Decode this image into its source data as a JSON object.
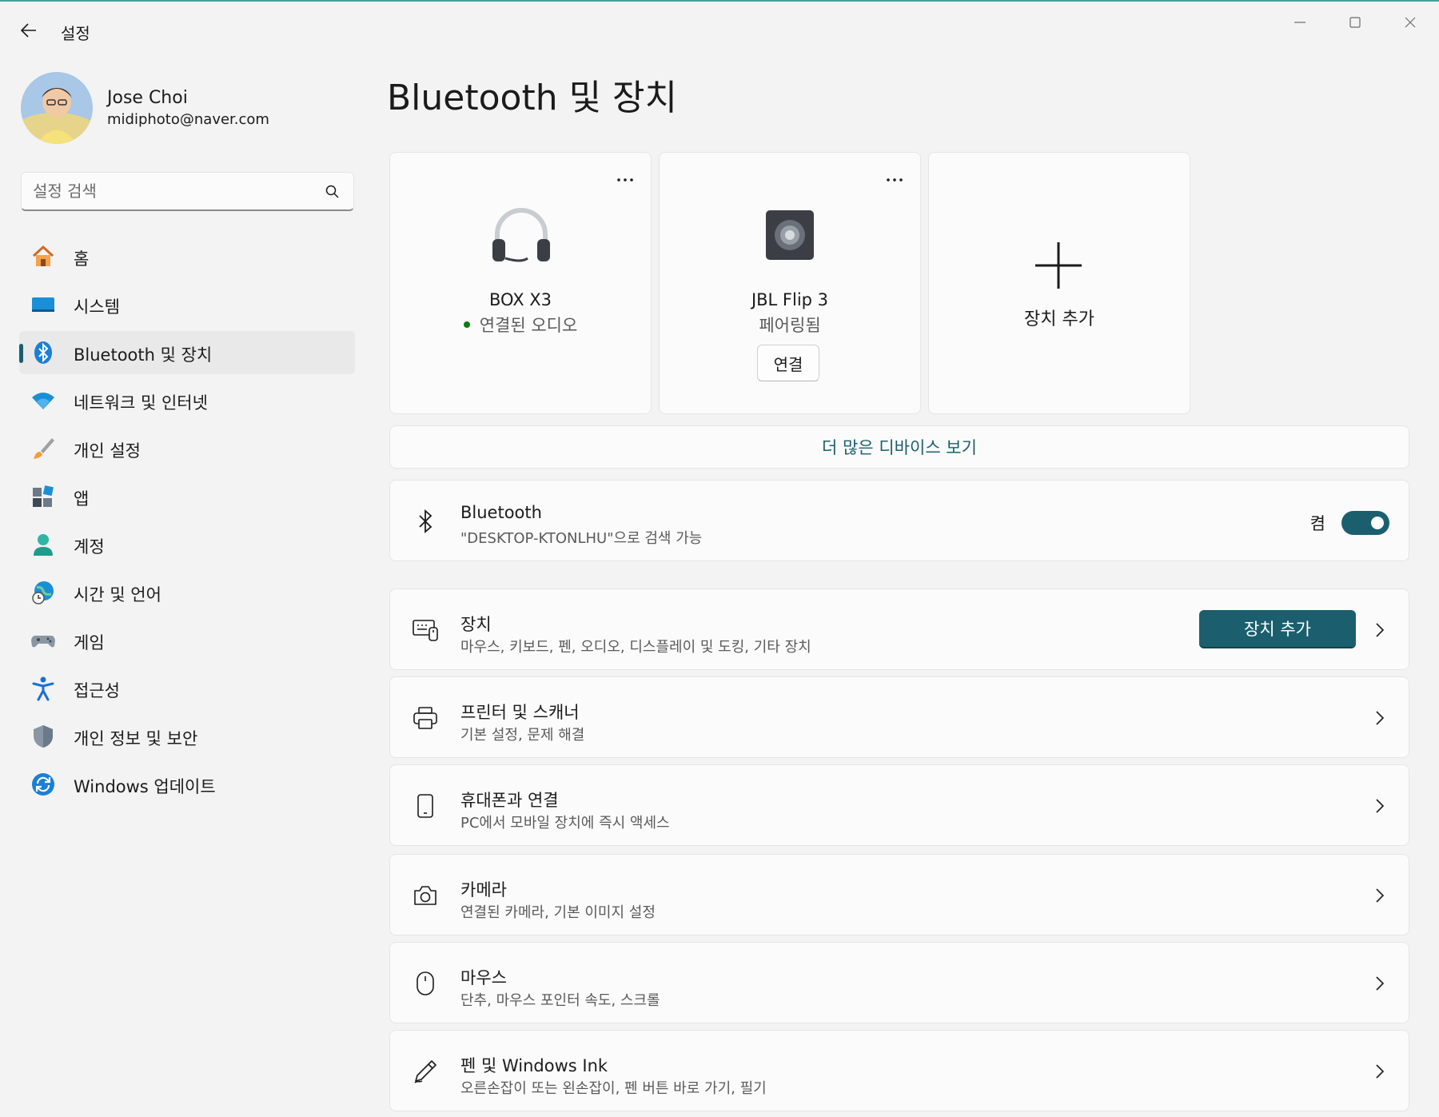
{
  "window": {
    "title": "설정",
    "back_label": "←",
    "minimize_icon": "minimize-icon",
    "maximize_icon": "maximize-icon",
    "close_icon": "close-icon"
  },
  "profile": {
    "name": "Jose Choi",
    "email": "midiphoto@naver.com"
  },
  "search": {
    "placeholder": "설정 검색",
    "value": ""
  },
  "nav": {
    "items": [
      {
        "label": "홈",
        "icon": "home-icon"
      },
      {
        "label": "시스템",
        "icon": "system-icon"
      },
      {
        "label": "Bluetooth 및 장치",
        "icon": "bluetooth-icon",
        "active": true
      },
      {
        "label": "네트워크 및 인터넷",
        "icon": "wifi-icon"
      },
      {
        "label": "개인 설정",
        "icon": "brush-icon"
      },
      {
        "label": "앱",
        "icon": "apps-icon"
      },
      {
        "label": "계정",
        "icon": "account-icon"
      },
      {
        "label": "시간 및 언어",
        "icon": "time-language-icon"
      },
      {
        "label": "게임",
        "icon": "gamepad-icon"
      },
      {
        "label": "접근성",
        "icon": "accessibility-icon"
      },
      {
        "label": "개인 정보 및 보안",
        "icon": "shield-icon"
      },
      {
        "label": "Windows 업데이트",
        "icon": "update-icon"
      }
    ]
  },
  "main": {
    "title": "Bluetooth 및 장치",
    "devices": [
      {
        "name": "BOX X3",
        "status": "연결된 오디오",
        "icon": "headphones-icon",
        "connected": true
      },
      {
        "name": "JBL Flip 3",
        "status": "페어링됨",
        "icon": "speaker-icon",
        "button": "연결"
      }
    ],
    "add_device_card": "장치 추가",
    "more_devices": "더 많은 디바이스 보기",
    "bluetooth": {
      "title": "Bluetooth",
      "subtitle": "\"DESKTOP-KTONLHU\"으로 검색 가능",
      "state_label": "켬",
      "on": true
    },
    "rows": [
      {
        "title": "장치",
        "subtitle": "마우스, 키보드, 펜, 오디오, 디스플레이 및 도킹, 기타 장치",
        "icon": "devices-icon",
        "button": "장치 추가"
      },
      {
        "title": "프린터 및 스캐너",
        "subtitle": "기본 설정, 문제 해결",
        "icon": "printer-icon"
      },
      {
        "title": "휴대폰과 연결",
        "subtitle": "PC에서 모바일 장치에 즉시 액세스",
        "icon": "phone-icon"
      },
      {
        "title": "카메라",
        "subtitle": "연결된 카메라, 기본 이미지 설정",
        "icon": "camera-icon"
      },
      {
        "title": "마우스",
        "subtitle": "단추, 마우스 포인터 속도, 스크롤",
        "icon": "mouse-icon"
      },
      {
        "title": "펜 및 Windows Ink",
        "subtitle": "오른손잡이 또는 왼손잡이, 펜 버튼 바로 가기, 필기",
        "icon": "pen-icon"
      }
    ]
  },
  "colors": {
    "accent": "#1b5f6e",
    "background": "#f3f3f3",
    "card": "#fbfbfb",
    "connected_dot": "#0f7b0f"
  }
}
